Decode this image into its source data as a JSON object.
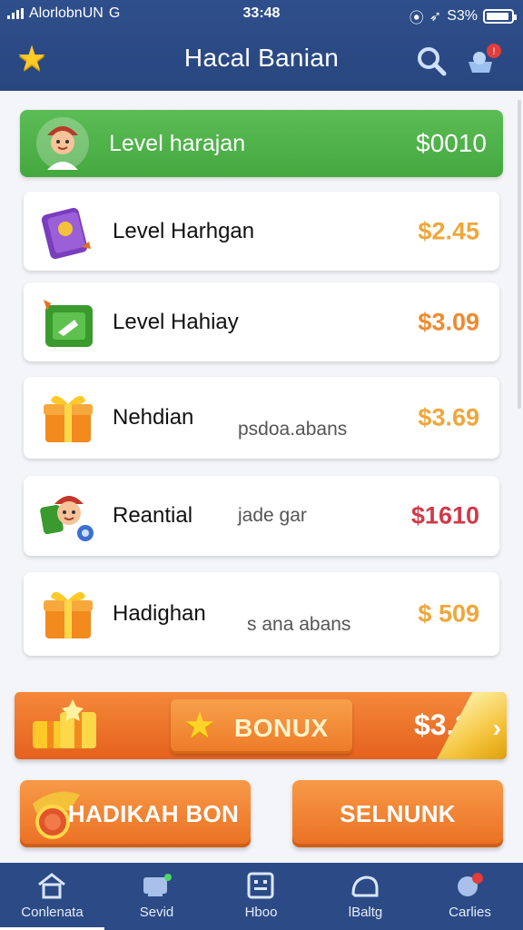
{
  "status_bar": {
    "carrier": "AlorlobnUN",
    "network": "G",
    "time": "33:48",
    "battery": "S3%"
  },
  "header": {
    "title": "Hacal Banian",
    "icons": [
      "star-icon",
      "search-icon",
      "cart-icon"
    ]
  },
  "featured": {
    "label": "Level harajan",
    "price": "$0010",
    "icon": "avatar-icon",
    "color": "#4caf4a"
  },
  "items": [
    {
      "name": "Level Harhgan",
      "sub": "",
      "price": "$2.45",
      "price_color": "#f0a63a",
      "icon": "purple-card-icon"
    },
    {
      "name": "Level Hahiay",
      "sub": "",
      "price": "$3.09",
      "price_color": "#ee8a2e",
      "icon": "green-card-icon"
    },
    {
      "name": "Nehdian",
      "sub": "psdoa.abans",
      "price": "$3.69",
      "price_color": "#f0a63a",
      "icon": "gift-box-icon"
    },
    {
      "name": "Reantial",
      "sub": "jade gar",
      "price": "$1610",
      "price_color": "#d03a4a",
      "icon": "character-icon"
    },
    {
      "name": "Hadighan",
      "sub": "s ana abans",
      "price": "$ 509",
      "price_color": "#f0a63a",
      "icon": "gift-box-icon"
    }
  ],
  "bonus": {
    "label": "BONUX",
    "price": "$3.1",
    "icon": "star-icon"
  },
  "actions": {
    "left": "HADIKAH BON",
    "right": "SELNUNK"
  },
  "tabs": [
    {
      "label": "Conlenata",
      "icon": "home-icon"
    },
    {
      "label": "Sevid",
      "icon": "inbox-icon"
    },
    {
      "label": "Hboo",
      "icon": "grid-icon"
    },
    {
      "label": "lBaltg",
      "icon": "bag-icon"
    },
    {
      "label": "Carlies",
      "icon": "chat-icon"
    }
  ],
  "colors": {
    "header": "#2b4a86",
    "accent_orange": "#ee7a27",
    "accent_green": "#4caf4a"
  }
}
